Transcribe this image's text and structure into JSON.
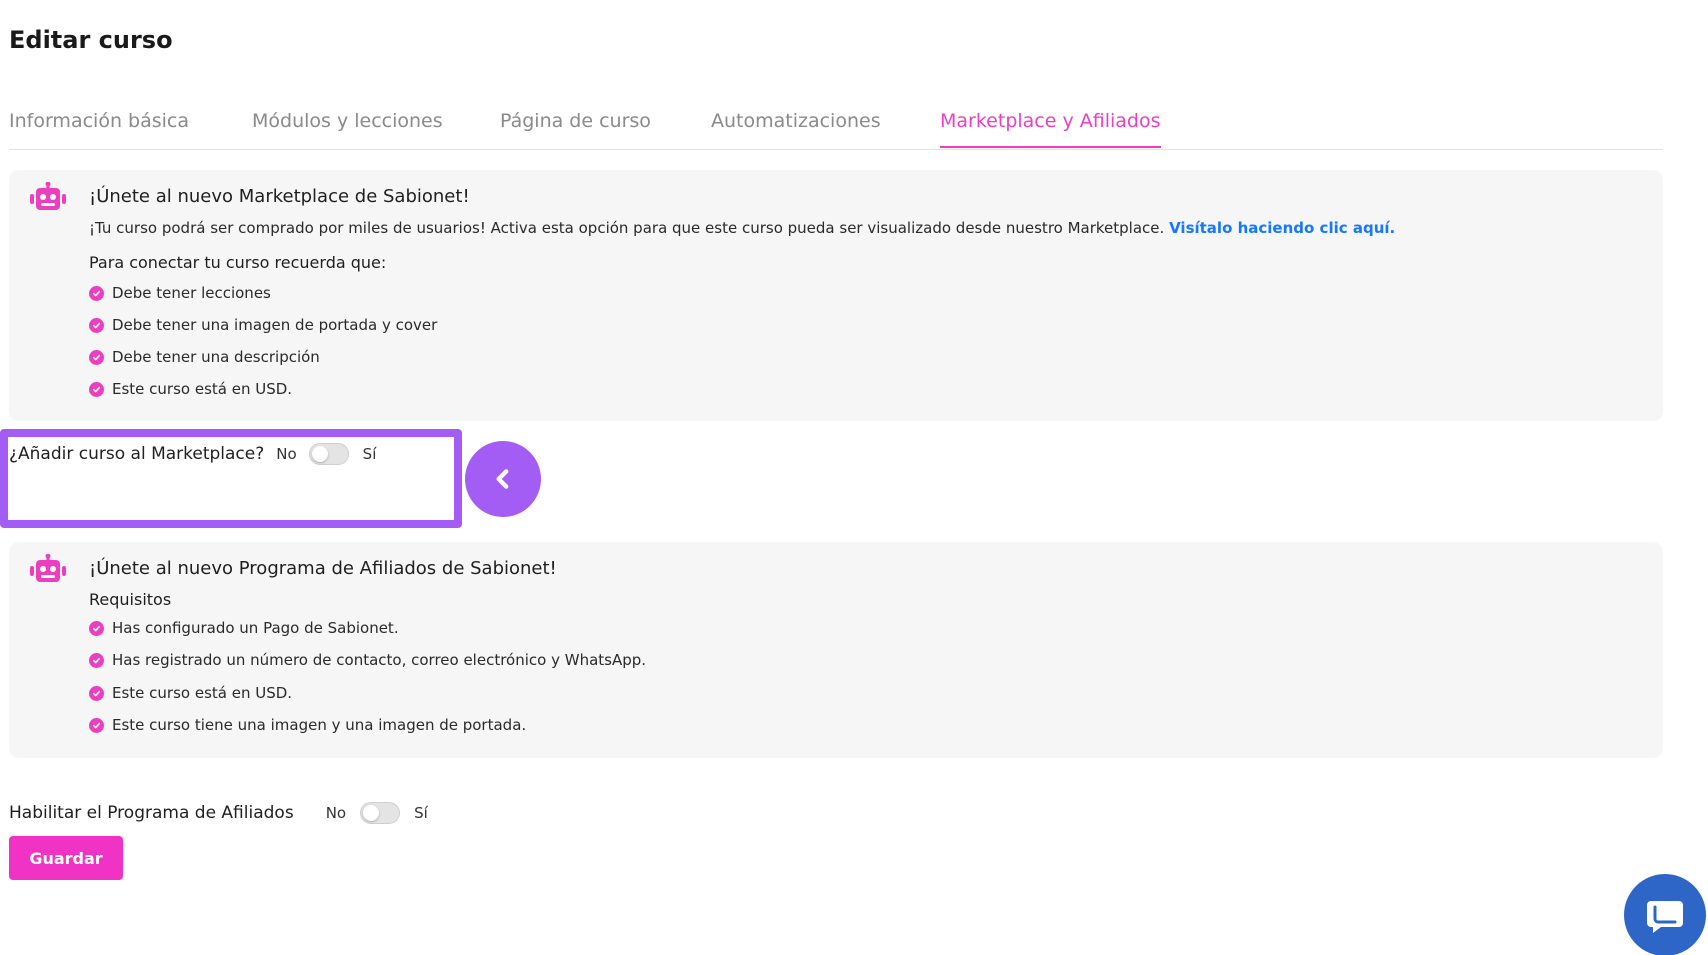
{
  "page": {
    "title": "Editar curso"
  },
  "tabs": [
    {
      "label": "Información básica"
    },
    {
      "label": "Módulos y lecciones"
    },
    {
      "label": "Página de curso"
    },
    {
      "label": "Automatizaciones"
    },
    {
      "label": "Marketplace y Afiliados",
      "active": true
    }
  ],
  "marketplace": {
    "title": "¡Únete al nuevo Marketplace de Sabionet!",
    "description": "¡Tu curso podrá ser comprado por miles de usuarios! Activa esta opción para que este curso pueda ser visualizado desde nuestro Marketplace.",
    "link_text": "Visítalo haciendo clic aquí.",
    "requirements_title": "Para conectar tu curso recuerda que:",
    "requirements": [
      "Debe tener lecciones",
      "Debe tener una imagen de portada y cover",
      "Debe tener una descripción",
      "Este curso está en USD."
    ],
    "toggle": {
      "label": "¿Añadir curso al Marketplace?",
      "off_label": "No",
      "on_label": "Sí",
      "enabled": false
    }
  },
  "affiliates": {
    "title": "¡Únete al nuevo Programa de Afiliados de Sabionet!",
    "requirements_title": "Requisitos",
    "requirements": [
      "Has configurado un Pago de Sabionet.",
      "Has registrado un número de contacto, correo electrónico y WhatsApp.",
      "Este curso está en USD.",
      "Este curso tiene una imagen y una imagen de portada."
    ],
    "toggle": {
      "label": "Habilitar el Programa de Afiliados",
      "off_label": "No",
      "on_label": "Sí",
      "enabled": false
    }
  },
  "actions": {
    "save_label": "Guardar"
  },
  "icons": {
    "robot": "robot-icon",
    "check": "check-circle-icon",
    "collapse": "chevron-left-icon",
    "chat": "chat-bubble-icon"
  },
  "colors": {
    "accent": "#ec3fc0",
    "highlight": "#a35df5",
    "link": "#1677ff",
    "chat": "#2d66c7"
  }
}
